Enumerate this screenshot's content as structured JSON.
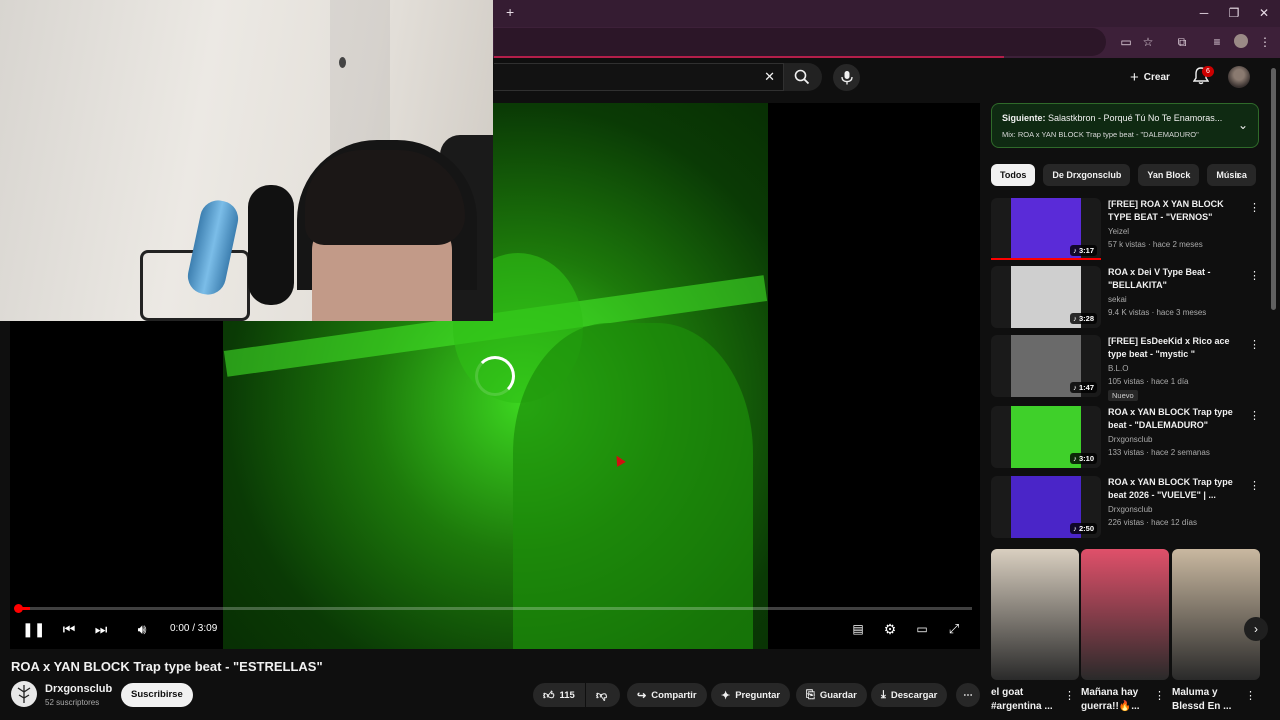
{
  "browser": {
    "new_tab": "+",
    "minimize": "─",
    "restore": "❐",
    "close": "✕"
  },
  "header": {
    "search_clear": "✕",
    "create_label": "Crear",
    "notification_count": "6"
  },
  "player": {
    "time": "0:00 / 3:09",
    "progress_fraction": 0.013
  },
  "video": {
    "title": "ROA x YAN BLOCK Trap type beat - \"ESTRELLAS\"",
    "channel": "Drxgonsclub",
    "subscribers": "52 suscriptores",
    "subscribe_label": "Suscribirse",
    "likes": "115",
    "share_label": "Compartir",
    "ask_label": "Preguntar",
    "save_label": "Guardar",
    "download_label": "Descargar"
  },
  "upnext": {
    "prefix": "Siguiente:",
    "title": "Salastkbron - Porqué Tú No Te Enamoras...",
    "mix": "Mix: ROA x YAN BLOCK Trap type beat - \"DALEMADURO\""
  },
  "chips": [
    "Todos",
    "De Drxgonsclub",
    "Yan Block",
    "Música"
  ],
  "recommendations": [
    {
      "title": "[FREE] ROA X YAN BLOCK TYPE BEAT - \"VERNOS\"",
      "channel": "Yeizel",
      "meta": "57 k vistas · hace 2 meses",
      "duration": "3:17",
      "badge": "",
      "color": "#5a2bd8"
    },
    {
      "title": "ROA x Dei V Type Beat - \"BELLAKITA\"",
      "channel": "sekai",
      "meta": "9.4 K vistas · hace 3 meses",
      "duration": "3:28",
      "badge": "",
      "color": "#cfcfcf"
    },
    {
      "title": "[FREE] EsDeeKid x Rico ace type beat - \"mystic \"",
      "channel": "B.L.O",
      "meta": "105 vistas · hace 1 día",
      "duration": "1:47",
      "badge": "Nuevo",
      "color": "#6a6a6a"
    },
    {
      "title": "ROA x YAN BLOCK Trap type beat - \"DALEMADURO\"",
      "channel": "Drxgonsclub",
      "meta": "133 vistas · hace 2 semanas",
      "duration": "3:10",
      "badge": "",
      "color": "#3fd02a"
    },
    {
      "title": "ROA x YAN BLOCK Trap type beat 2026 - \"VUELVE\" | ...",
      "channel": "Drxgonsclub",
      "meta": "226 vistas · hace 12 días",
      "duration": "2:50",
      "badge": "",
      "color": "#4a25c8"
    }
  ],
  "shorts": [
    {
      "title": "el goat #argentina ...",
      "color": "#d9cfc0"
    },
    {
      "title": "Mañana hay guerra!!🔥...",
      "color": "#e0506a"
    },
    {
      "title": "Maluma y Blessd En ...",
      "color": "#c9b8a0"
    }
  ]
}
